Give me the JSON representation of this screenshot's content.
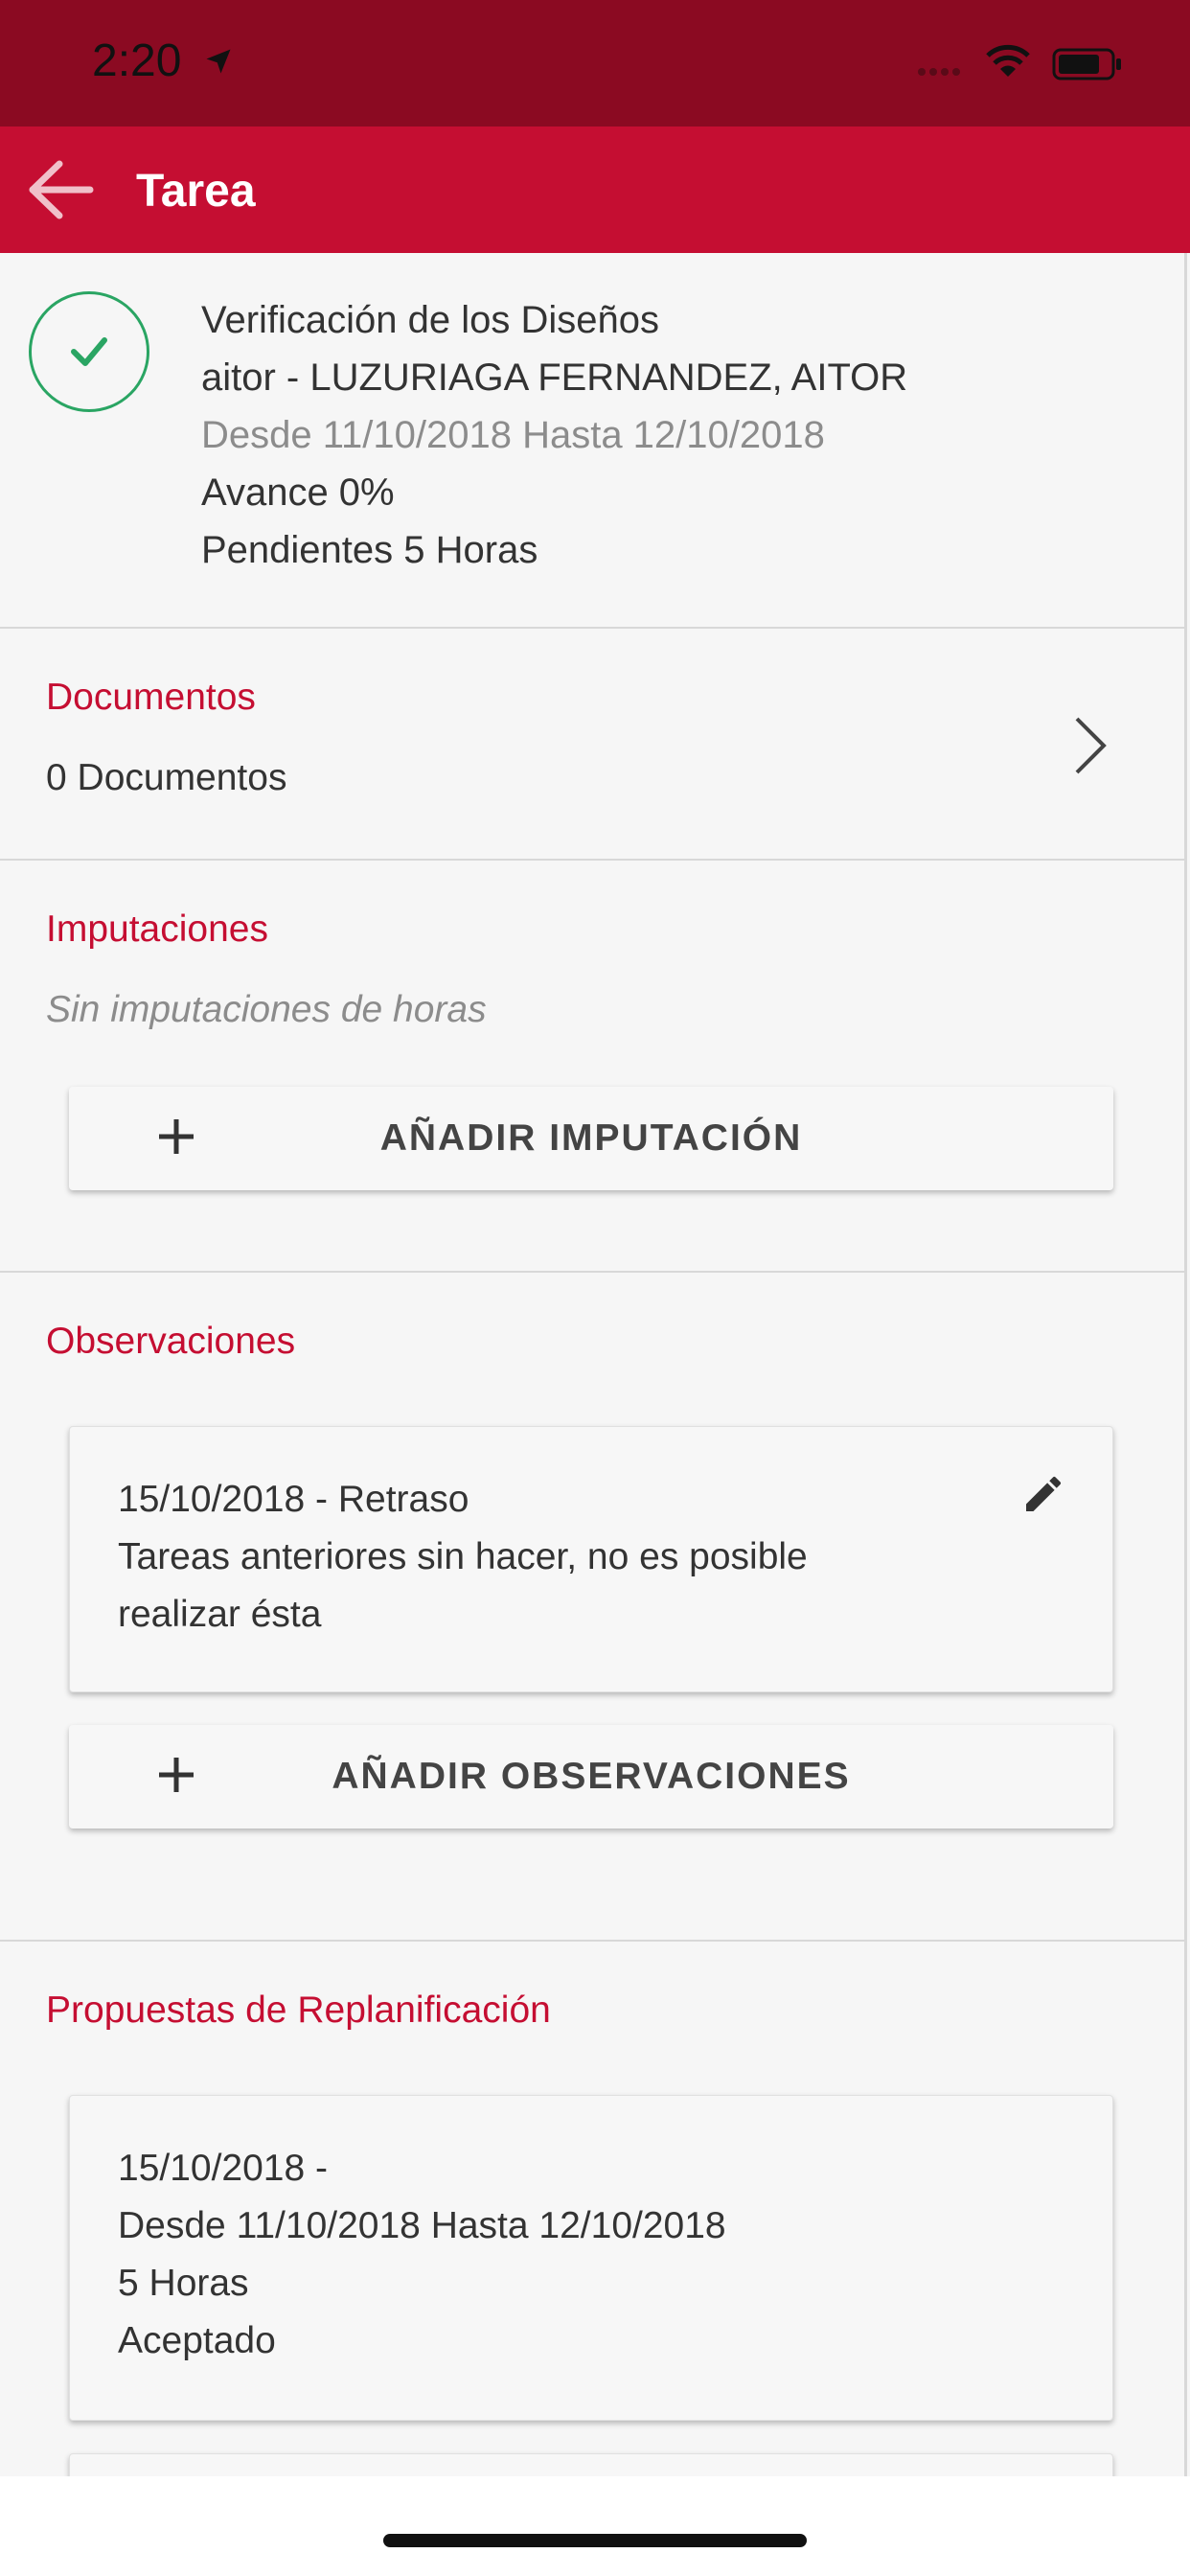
{
  "status_bar": {
    "time": "2:20"
  },
  "app_bar": {
    "title": "Tarea"
  },
  "task": {
    "title": "Verificación de los Diseños",
    "assignee": "aitor - LUZURIAGA FERNANDEZ, AITOR",
    "dates": "Desde 11/10/2018 Hasta 12/10/2018",
    "progress": "Avance 0%",
    "pending": "Pendientes 5 Horas",
    "status_color": "#2aa563"
  },
  "documents": {
    "title": "Documentos",
    "count": "0 Documentos"
  },
  "imputaciones": {
    "title": "Imputaciones",
    "empty": "Sin imputaciones de horas",
    "add_label": "AÑADIR IMPUTACIÓN"
  },
  "observaciones": {
    "title": "Observaciones",
    "items": [
      {
        "line1": "15/10/2018 - Retraso",
        "line2": "Tareas anteriores sin hacer, no es posible",
        "line3": "realizar ésta"
      }
    ],
    "add_label": "AÑADIR OBSERVACIONES"
  },
  "replanificacion": {
    "title": "Propuestas de Replanificación",
    "items": [
      {
        "line1": "15/10/2018 -",
        "line2": "Desde 11/10/2018 Hasta 12/10/2018",
        "line3": "5 Horas",
        "line4": "Aceptado"
      }
    ]
  },
  "colors": {
    "accent": "#c50e32",
    "status_bar": "#8b0a22",
    "success": "#2aa563"
  }
}
